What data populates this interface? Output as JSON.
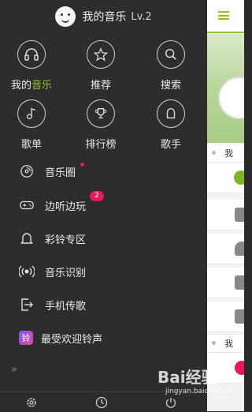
{
  "header": {
    "username": "我的音乐",
    "level": "Lv.2"
  },
  "grid": [
    {
      "label_prefix": "我的",
      "label_highlight": "音乐",
      "icon": "headphones-icon"
    },
    {
      "label": "推荐",
      "icon": "star-icon"
    },
    {
      "label": "搜索",
      "icon": "search-icon"
    },
    {
      "label": "歌单",
      "icon": "music-note-icon"
    },
    {
      "label": "排行榜",
      "icon": "trophy-icon"
    },
    {
      "label": "歌手",
      "icon": "person-icon"
    }
  ],
  "list": [
    {
      "label": "音乐圈",
      "icon": "disc-icon",
      "dot": true
    },
    {
      "label": "边听边玩",
      "icon": "gamepad-icon",
      "badge": "2"
    },
    {
      "label": "彩铃专区",
      "icon": "bell-icon"
    },
    {
      "label": "音乐识别",
      "icon": "sound-recognize-icon"
    },
    {
      "label": "手机传歌",
      "icon": "phone-transfer-icon"
    },
    {
      "label": "最受欢迎铃声",
      "icon": "ringtone-app-icon",
      "app_icon_text": "铃"
    }
  ],
  "expand_symbol": "»",
  "bottom": [
    {
      "icon": "settings-icon"
    },
    {
      "icon": "clock-icon"
    },
    {
      "icon": "power-icon"
    }
  ],
  "main": {
    "section1": "我",
    "section2": "我"
  },
  "watermark": {
    "text": "Bai经验",
    "url": "jingyan.baidu.com"
  },
  "colors": {
    "accent": "#8fc31f",
    "badge": "#e6195b",
    "drawer_bg": "#2d2d2d"
  }
}
